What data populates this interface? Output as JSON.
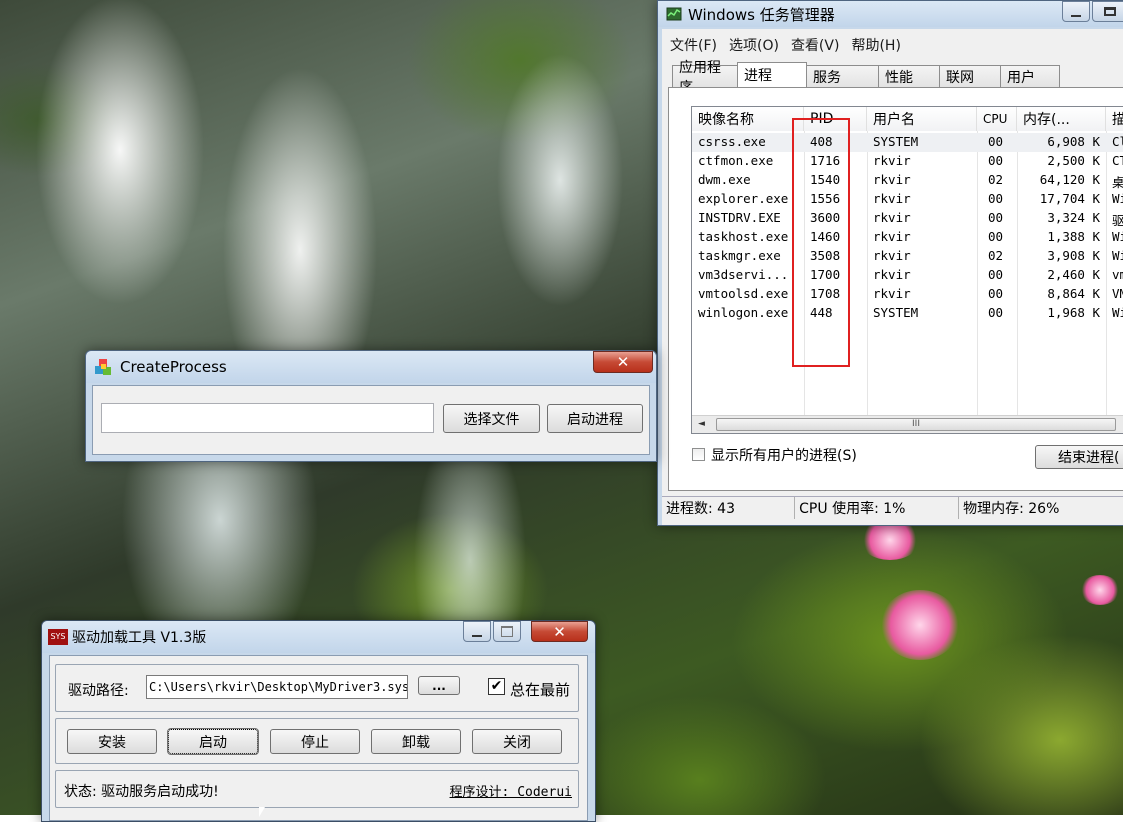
{
  "taskmgr": {
    "title": "Windows 任务管理器",
    "menu": [
      "文件(F)",
      "选项(O)",
      "查看(V)",
      "帮助(H)"
    ],
    "tabs": [
      "应用程序",
      "进程",
      "服务",
      "性能",
      "联网",
      "用户"
    ],
    "active_tab": "进程",
    "columns": [
      "映像名称",
      "PID",
      "用户名",
      "CPU",
      "内存(...",
      "描"
    ],
    "processes": [
      {
        "name": "csrss.exe",
        "pid": "408",
        "user": "SYSTEM",
        "cpu": "00",
        "mem": "6,908 K",
        "desc": "Cl"
      },
      {
        "name": "ctfmon.exe",
        "pid": "1716",
        "user": "rkvir",
        "cpu": "00",
        "mem": "2,500 K",
        "desc": "CT"
      },
      {
        "name": "dwm.exe",
        "pid": "1540",
        "user": "rkvir",
        "cpu": "02",
        "mem": "64,120 K",
        "desc": "桌"
      },
      {
        "name": "explorer.exe",
        "pid": "1556",
        "user": "rkvir",
        "cpu": "00",
        "mem": "17,704 K",
        "desc": "Wi"
      },
      {
        "name": "INSTDRV.EXE",
        "pid": "3600",
        "user": "rkvir",
        "cpu": "00",
        "mem": "3,324 K",
        "desc": "驱"
      },
      {
        "name": "taskhost.exe",
        "pid": "1460",
        "user": "rkvir",
        "cpu": "00",
        "mem": "1,388 K",
        "desc": "Wi"
      },
      {
        "name": "taskmgr.exe",
        "pid": "3508",
        "user": "rkvir",
        "cpu": "02",
        "mem": "3,908 K",
        "desc": "Wi"
      },
      {
        "name": "vm3dservi...",
        "pid": "1700",
        "user": "rkvir",
        "cpu": "00",
        "mem": "2,460 K",
        "desc": "vm"
      },
      {
        "name": "vmtoolsd.exe",
        "pid": "1708",
        "user": "rkvir",
        "cpu": "00",
        "mem": "8,864 K",
        "desc": "VM"
      },
      {
        "name": "winlogon.exe",
        "pid": "448",
        "user": "SYSTEM",
        "cpu": "00",
        "mem": "1,968 K",
        "desc": "Wi"
      }
    ],
    "show_all_users_label": "显示所有用户的进程(S)",
    "end_process_label": "结束进程(",
    "scroll_grip": "III",
    "status": {
      "proc_count": "进程数: 43",
      "cpu_usage": "CPU 使用率: 1%",
      "phys_mem": "物理内存: 26%"
    },
    "highlight_color": "#e02020"
  },
  "createproc": {
    "title": "CreateProcess",
    "path_value": "",
    "choose_file_label": "选择文件",
    "start_process_label": "启动进程",
    "close_glyph": "✕"
  },
  "drvtool": {
    "icon_text": "SYS",
    "title": "驱动加载工具 V1.3版",
    "path_label": "驱动路径:",
    "path_value": "C:\\Users\\rkvir\\Desktop\\MyDriver3.sys",
    "browse_label": "...",
    "always_on_top_label": "总在最前",
    "always_on_top_checked": true,
    "buttons": [
      "安装",
      "启动",
      "停止",
      "卸载",
      "关闭"
    ],
    "status_text": "状态: 驱动服务启动成功!",
    "author_text": "程序设计: Coderui",
    "close_glyph": "✕"
  },
  "icons": {
    "taskmgr_icon": "task-manager-icon",
    "createproc_icon": "colored-blocks-icon",
    "checkmark": "✔"
  }
}
